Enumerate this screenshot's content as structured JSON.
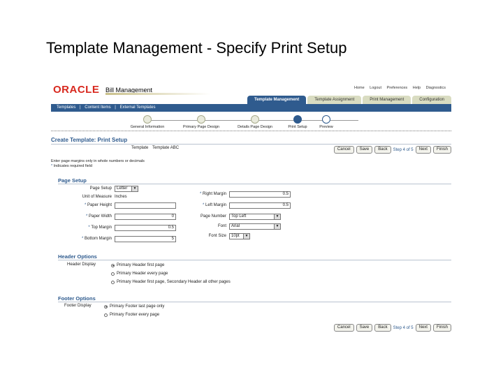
{
  "slide_title": "Template Management  - Specify Print Setup",
  "app": {
    "logo": "ORACLE",
    "brand": "Bill Management",
    "global_links": [
      "Home",
      "Logout",
      "Preferences",
      "Help",
      "Diagnostics"
    ],
    "tabs": [
      {
        "label": "Template Management",
        "active": true
      },
      {
        "label": "Template Assignment",
        "active": false
      },
      {
        "label": "Print Management",
        "active": false
      },
      {
        "label": "Configuration",
        "active": false
      }
    ],
    "subnav": [
      "Templates",
      "|",
      "Content Items",
      "|",
      "External Templates"
    ],
    "train": [
      {
        "label": "General Information",
        "state": "done"
      },
      {
        "label": "Primary Page Design",
        "state": "done"
      },
      {
        "label": "Details Page Design",
        "state": "done"
      },
      {
        "label": "Print Setup",
        "state": "active"
      },
      {
        "label": "Preview",
        "state": "next"
      }
    ],
    "heading": "Create Template: Print Setup",
    "template_label": "Template",
    "template_name": "Template ABC",
    "buttons": {
      "cancel": "Cancel",
      "save": "Save",
      "back": "Back",
      "next": "Next",
      "finish": "Finish"
    },
    "step_text": "Step 4 of 5",
    "instructions": [
      "Enter page margins only in whole numbers or decimals",
      "Indicates required field"
    ],
    "required_marker": "*",
    "page_setup": {
      "title": "Page Setup",
      "page_setup_label": "Page Setup",
      "page_setup_value": "Letter",
      "uom_label": "Unit of Measure",
      "uom_value": "Inches",
      "paper_height_label": "Paper Height",
      "paper_height_value": "",
      "paper_width_label": "Paper Width",
      "paper_width_value": "0",
      "top_margin_label": "Top Margin",
      "top_margin_value": "0.5",
      "bottom_margin_label": "Bottom Margin",
      "bottom_margin_value": "5",
      "right_margin_label": "Right Margin",
      "right_margin_value": "0.5",
      "left_margin_label": "Left Margin",
      "left_margin_value": "0.5",
      "page_number_label": "Page Number",
      "page_number_value": "Top Left",
      "font_label": "Font",
      "font_value": "Arial",
      "font_size_label": "Font Size",
      "font_size_value": "10pt"
    },
    "header_options": {
      "title": "Header Options",
      "display_label": "Header Display",
      "options": [
        "Primary Header first page",
        "Primary Header every page",
        "Primary Header first page, Secondary Header all other pages"
      ],
      "selected": 0
    },
    "footer_options": {
      "title": "Footer Options",
      "display_label": "Footer Display",
      "options": [
        "Primary Footer last page only",
        "Primary Footer every page"
      ],
      "selected": 0
    }
  }
}
